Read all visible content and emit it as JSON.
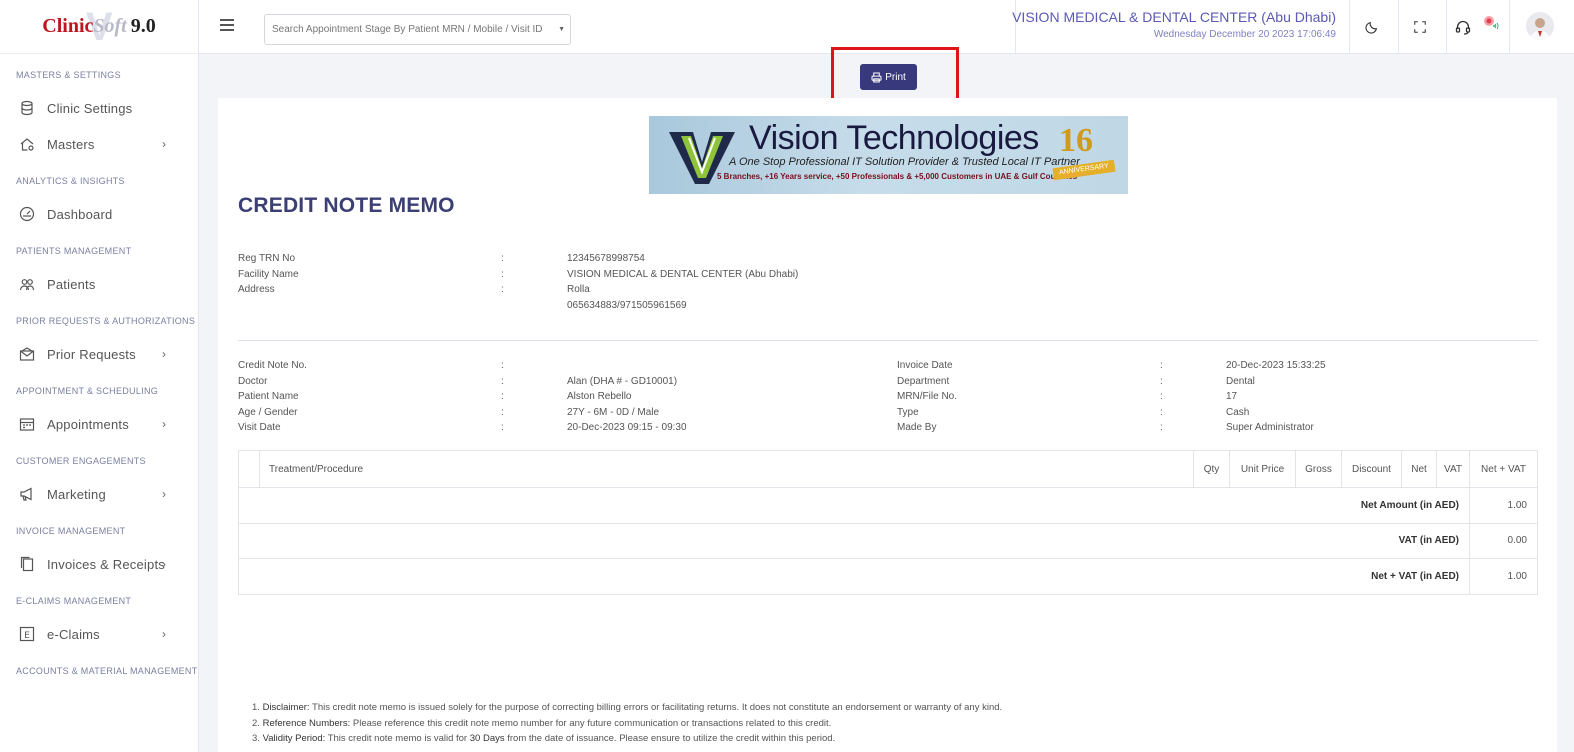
{
  "brand": {
    "logo_part1": "Clinic",
    "logo_part2": "Soft",
    "logo_version": "9.0"
  },
  "sidebar": {
    "sections": [
      {
        "title": "MASTERS & SETTINGS",
        "items": [
          {
            "label": "Clinic Settings",
            "icon": "database-icon",
            "has_chevron": false
          },
          {
            "label": "Masters",
            "icon": "home-gear-icon",
            "has_chevron": true
          }
        ]
      },
      {
        "title": "ANALYTICS & INSIGHTS",
        "items": [
          {
            "label": "Dashboard",
            "icon": "gauge-icon",
            "has_chevron": false
          }
        ]
      },
      {
        "title": "PATIENTS MANAGEMENT",
        "items": [
          {
            "label": "Patients",
            "icon": "users-icon",
            "has_chevron": false
          }
        ]
      },
      {
        "title": "PRIOR REQUESTS & AUTHORIZATIONS",
        "items": [
          {
            "label": "Prior Requests",
            "icon": "envelope-icon",
            "has_chevron": true
          }
        ]
      },
      {
        "title": "APPOINTMENT & SCHEDULING",
        "items": [
          {
            "label": "Appointments",
            "icon": "calendar-icon",
            "has_chevron": true
          }
        ]
      },
      {
        "title": "CUSTOMER ENGAGEMENTS",
        "items": [
          {
            "label": "Marketing",
            "icon": "megaphone-icon",
            "has_chevron": true
          }
        ]
      },
      {
        "title": "INVOICE MANAGEMENT",
        "items": [
          {
            "label": "Invoices & Receipts",
            "icon": "copy-icon",
            "has_chevron": true
          }
        ]
      },
      {
        "title": "E-CLAIMS MANAGEMENT",
        "items": [
          {
            "label": "e-Claims",
            "icon": "e-box-icon",
            "has_chevron": true
          }
        ]
      },
      {
        "title": "ACCOUNTS & MATERIAL MANAGEMENT",
        "items": []
      }
    ]
  },
  "header": {
    "search_placeholder": "Search Appointment Stage By Patient MRN / Mobile / Visit ID",
    "clinic_name": "VISION MEDICAL & DENTAL CENTER (Abu Dhabi)",
    "datetime": "Wednesday December 20 2023 17:06:49"
  },
  "print_label": "Print",
  "banner": {
    "title": "Vision Technologies",
    "tagline": "A One Stop Professional IT Solution Provider & Trusted Local IT Partner",
    "stats": "5 Branches, +16 Years service, +50 Professionals & +5,000 Customers in UAE & Gulf Countries",
    "anniversary_number": "16",
    "anniversary_text": "ANNIVERSARY"
  },
  "memo": {
    "title": "CREDIT NOTE MEMO",
    "colon": ":",
    "facility": [
      {
        "label": "Reg TRN No",
        "value": "12345678998754"
      },
      {
        "label": "Facility Name",
        "value": "VISION MEDICAL & DENTAL CENTER (Abu Dhabi)"
      },
      {
        "label": "Address",
        "value": "Rolla"
      },
      {
        "label": "",
        "value": "065634883/971505961569"
      }
    ],
    "left_details": [
      {
        "label": "Credit Note No.",
        "value": ""
      },
      {
        "label": "Doctor",
        "value": "Alan (DHA # - GD10001)"
      },
      {
        "label": "Patient Name",
        "value": "Alston Rebello"
      },
      {
        "label": "Age / Gender",
        "value": "27Y - 6M - 0D / Male"
      },
      {
        "label": "Visit Date",
        "value": "20-Dec-2023 09:15 - 09:30"
      }
    ],
    "right_details": [
      {
        "label": "Invoice Date",
        "value": "20-Dec-2023 15:33:25"
      },
      {
        "label": "Department",
        "value": "Dental"
      },
      {
        "label": "MRN/File No.",
        "value": "17"
      },
      {
        "label": "Type",
        "value": "Cash"
      },
      {
        "label": "Made By",
        "value": "Super Administrator"
      }
    ],
    "table": {
      "headers": [
        "",
        "Treatment/Procedure",
        "Qty",
        "Unit Price",
        "Gross",
        "Discount",
        "Net",
        "VAT",
        "Net + VAT"
      ],
      "totals": [
        {
          "label": "Net Amount (in AED)",
          "value": "1.00"
        },
        {
          "label": "VAT (in AED)",
          "value": "0.00"
        },
        {
          "label": "Net + VAT (in AED)",
          "value": "1.00"
        }
      ]
    },
    "notes": [
      {
        "n": "1.",
        "title": "Disclaimer:",
        "text": " This credit note memo is issued solely for the purpose of correcting billing errors or facilitating returns. It does not constitute an endorsement or warranty of any kind."
      },
      {
        "n": "2.",
        "title": "Reference Numbers:",
        "text": " Please reference this credit note memo number for any future communication or transactions related to this credit."
      },
      {
        "n": "3.",
        "title": "Validity Period:",
        "text": " This credit note memo is valid for ",
        "bold": "30 Days",
        "tail": " from the date of issuance. Please ensure to utilize the credit within this period."
      }
    ]
  }
}
